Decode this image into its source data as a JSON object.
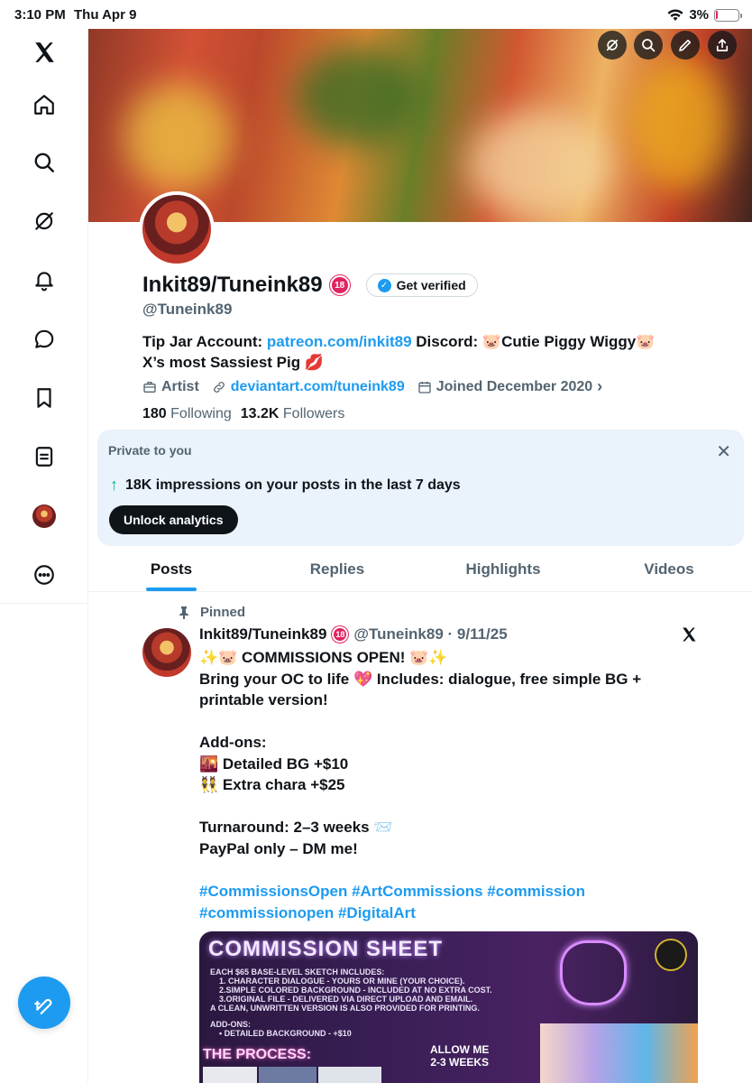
{
  "status_bar": {
    "time": "3:10 PM",
    "date": "Thu Apr 9",
    "battery": "3%"
  },
  "sidebar": {
    "items": [
      "x-logo",
      "home",
      "explore",
      "grok",
      "notifications",
      "messages",
      "bookmarks",
      "lists",
      "profile",
      "more"
    ]
  },
  "profile": {
    "name": "Inkit89/Tuneink89",
    "age_badge": "18",
    "get_verified": "Get verified",
    "handle": "@Tuneink89",
    "bio": {
      "tip_jar": "Tip Jar Account: ",
      "patreon": "patreon.com/inkit89",
      "discord": " Discord: 🐷Cutie Piggy Wiggy🐷",
      "line2": "X’s most Sassiest Pig 💋"
    },
    "category": "Artist",
    "website": "deviantart.com/tuneink89",
    "joined": "Joined December 2020",
    "following_count": "180",
    "following_label": "Following",
    "followers_count": "13.2K",
    "followers_label": "Followers"
  },
  "private_card": {
    "label": "Private to you",
    "stat": "18K impressions on your posts in the last 7 days",
    "button": "Unlock analytics"
  },
  "tabs": [
    "Posts",
    "Replies",
    "Highlights",
    "Videos"
  ],
  "post": {
    "pinned_label": "Pinned",
    "author": "Inkit89/Tuneink89",
    "meta": "@Tuneink89 · 9/11/25",
    "body": "✨🐷 COMMISSIONS OPEN! 🐷✨\nBring your OC to life 💖 Includes: dialogue, free simple BG + printable version!\n\nAdd-ons:\n🌇 Detailed BG +$10\n👯 Extra chara +$25\n\nTurnaround: 2–3 weeks 📨\nPayPal only – DM me!",
    "hashtags": "#CommissionsOpen #ArtCommissions #commission #commissionopen #DigitalArt",
    "media": {
      "title": "COMMISSION SHEET",
      "lines": [
        "EACH $65 BASE-LEVEL SKETCH INCLUDES:",
        "1. CHARACTER DIALOGUE - YOURS OR MINE (YOUR CHOICE).",
        "2.SIMPLE COLORED BACKGROUND - INCLUDED AT NO EXTRA COST.",
        "3.ORIGINAL FILE - DELIVERED VIA DIRECT UPLOAD AND EMAIL.",
        "A CLEAN, UNWRITTEN VERSION IS ALSO PROVIDED FOR PRINTING."
      ],
      "addons_title": "ADD-ONS:",
      "addon_1": "• DETAILED BACKGROUND - +$10",
      "process": "THE PROCESS:",
      "allow_1": "ALLOW ME",
      "allow_2": "2-3 WEEKS"
    }
  },
  "colors": {
    "accent": "#1d9bf0",
    "text": "#0f1419",
    "muted": "#536471",
    "card_bg": "#eaf2fb"
  }
}
